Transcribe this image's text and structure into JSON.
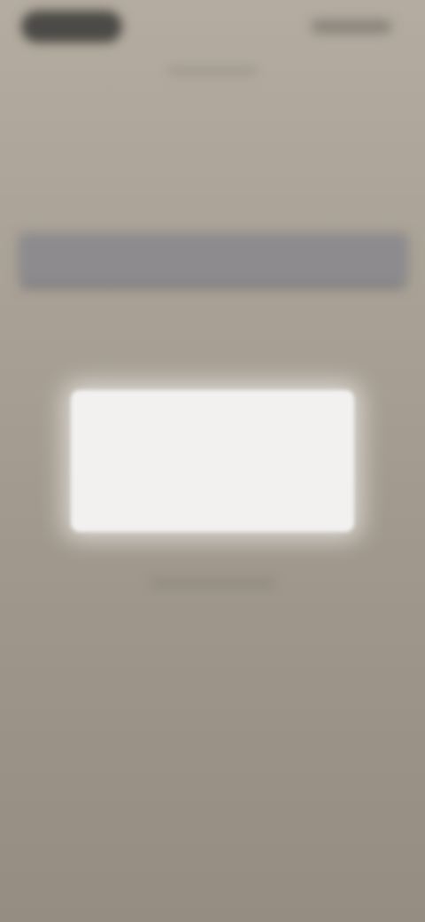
{
  "status_bar": {
    "time": "",
    "indicators": ""
  },
  "header": {
    "title": ""
  },
  "main": {
    "headline": "",
    "field": {
      "value": ""
    },
    "field_hint": ""
  },
  "modal": {
    "title": "",
    "message": ""
  },
  "colors": {
    "backdrop": "#958d82",
    "modal_bg": "#f3f1f0",
    "field_bg": "#8d8b8d"
  }
}
